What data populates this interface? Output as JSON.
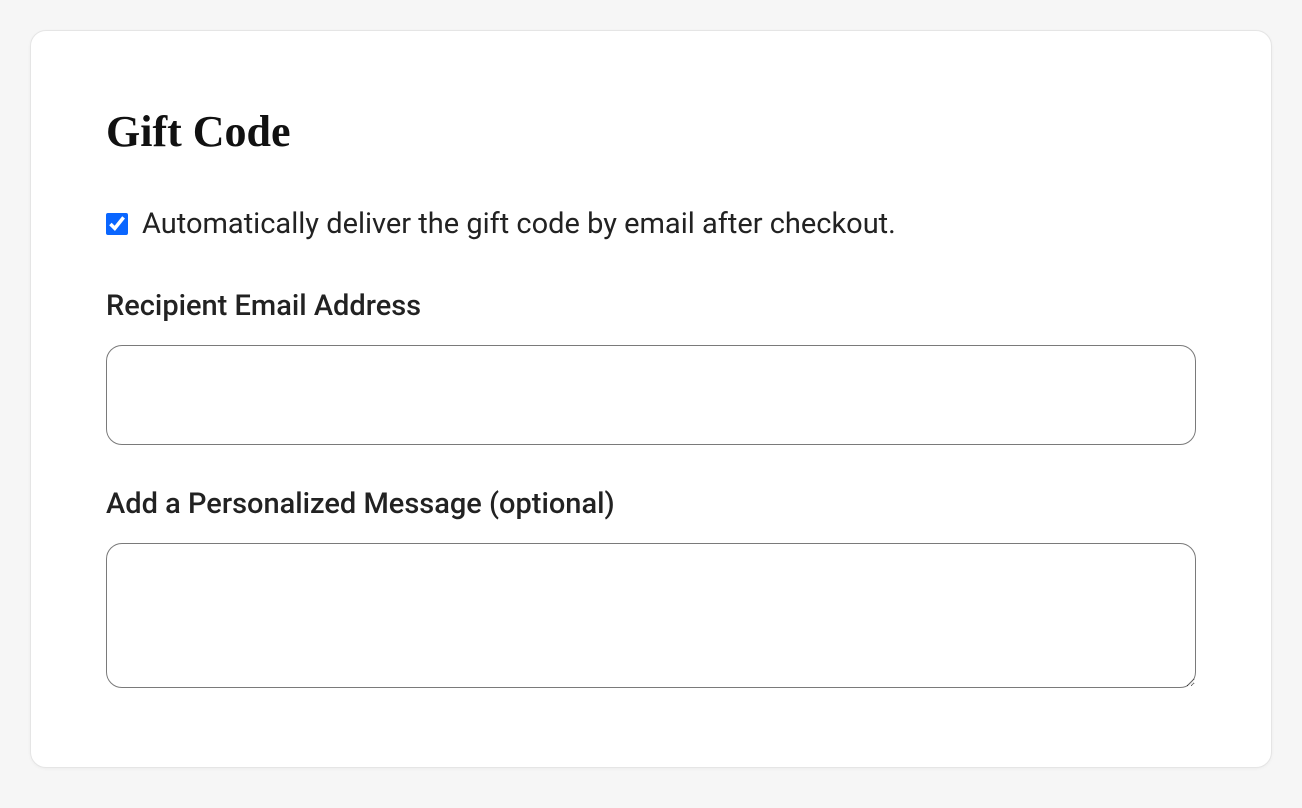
{
  "gift": {
    "title": "Gift Code",
    "auto_deliver_label": "Automatically deliver the gift code by email after checkout.",
    "auto_deliver_checked": true,
    "recipient_email_label": "Recipient Email Address",
    "recipient_email_value": "",
    "message_label": "Add a Personalized Message (optional)",
    "message_value": ""
  }
}
